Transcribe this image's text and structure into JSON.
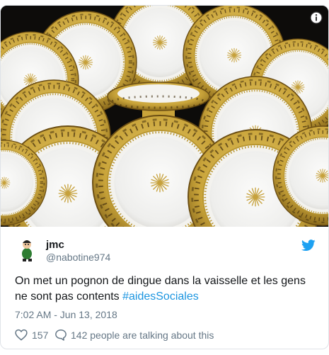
{
  "tweet": {
    "display_name": "jmc",
    "handle": "@nabotine974",
    "text_main": "On met un pognon de dingue dans la vaisselle et les gens ne sont pas contents ",
    "hashtag": "#aidesSociales",
    "timestamp": "7:02 AM - Jun 13, 2018",
    "like_count": "157",
    "talk_text": "142 people are talking about this"
  },
  "icons": {
    "info": "info-icon",
    "platform": "twitter-bird-icon",
    "like": "heart-icon",
    "reply": "speech-bubble-icon"
  },
  "colors": {
    "link": "#1b95e0",
    "text": "#14171a",
    "muted": "#657786",
    "gold": "#c9a43a"
  }
}
